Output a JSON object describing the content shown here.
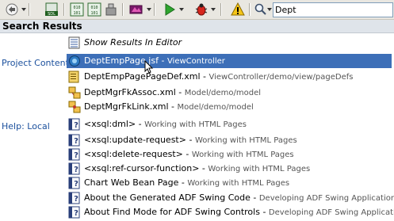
{
  "toolbar": {
    "search_value": "Dept"
  },
  "header": {
    "title": "Search Results"
  },
  "show_results": {
    "label": "Show Results In Editor"
  },
  "sections": {
    "project_content": "Project Content",
    "help_local": "Help: Local"
  },
  "project_items": [
    {
      "name": "DeptEmpPage.jsf",
      "sep": " - ",
      "path": "ViewController"
    },
    {
      "name": "DeptEmpPagePageDef.xml",
      "sep": " - ",
      "path": "ViewController/demo/view/pageDefs"
    },
    {
      "name": "DeptMgrFkAssoc.xml",
      "sep": " - ",
      "path": "Model/demo/model"
    },
    {
      "name": "DeptMgrFkLink.xml",
      "sep": " - ",
      "path": "Model/demo/model"
    }
  ],
  "help_items": [
    {
      "name": "<xsql:dml>",
      "sep": " - ",
      "path": "Working with HTML Pages"
    },
    {
      "name": "<xsql:update-request>",
      "sep": " - ",
      "path": "Working with HTML Pages"
    },
    {
      "name": "<xsql:delete-request>",
      "sep": " - ",
      "path": "Working with HTML Pages"
    },
    {
      "name": "<xsql:ref-cursor-function>",
      "sep": " - ",
      "path": "Working with HTML Pages"
    },
    {
      "name": "Chart Web Bean Page",
      "sep": " - ",
      "path": "Working with HTML Pages"
    },
    {
      "name": "About the Generated ADF Swing Code",
      "sep": " - ",
      "path": "Developing ADF Swing Applications"
    },
    {
      "name": "About Find Mode for ADF Swing Controls",
      "sep": " - ",
      "path": "Developing ADF Swing Applications"
    }
  ],
  "colors": {
    "selection": "#3d6fb8",
    "section_label": "#1a4f9c",
    "header_bg": "#dfe4ea"
  }
}
